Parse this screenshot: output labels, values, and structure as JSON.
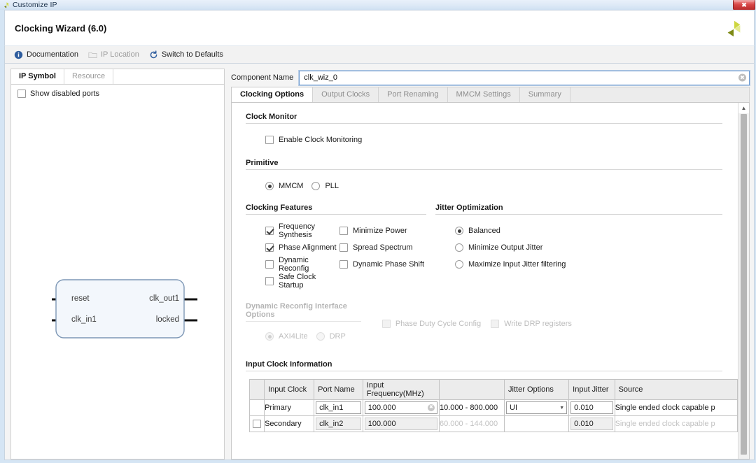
{
  "window": {
    "title": "Customize IP",
    "icon": "xilinx-logo-icon",
    "close_label": "✖"
  },
  "header": {
    "title": "Clocking Wizard (6.0)",
    "logo": "xilinx-logo-icon"
  },
  "toolbar": {
    "items": [
      {
        "label": "Documentation",
        "icon": "info-icon",
        "disabled": false
      },
      {
        "label": "IP Location",
        "icon": "folder-icon",
        "disabled": true
      },
      {
        "label": "Switch to Defaults",
        "icon": "refresh-icon",
        "disabled": false
      }
    ]
  },
  "left_panel": {
    "tabs": [
      {
        "label": "IP Symbol",
        "active": true
      },
      {
        "label": "Resource",
        "active": false
      }
    ],
    "show_disabled_ports": {
      "label": "Show disabled ports",
      "checked": false
    },
    "symbol": {
      "inputs": [
        "reset",
        "clk_in1"
      ],
      "outputs": [
        "clk_out1",
        "locked"
      ]
    }
  },
  "component_name": {
    "label": "Component Name",
    "value": "clk_wiz_0",
    "placeholder": "",
    "clear_icon": "clear-circle-icon"
  },
  "tabs": [
    {
      "label": "Clocking Options",
      "active": true
    },
    {
      "label": "Output Clocks",
      "active": false
    },
    {
      "label": "Port Renaming",
      "active": false
    },
    {
      "label": "MMCM Settings",
      "active": false
    },
    {
      "label": "Summary",
      "active": false
    }
  ],
  "sections": {
    "clock_monitor": {
      "title": "Clock Monitor",
      "options": [
        {
          "label": "Enable Clock Monitoring",
          "checked": false,
          "type": "checkbox"
        }
      ]
    },
    "primitive": {
      "title": "Primitive",
      "options": [
        {
          "label": "MMCM",
          "selected": true
        },
        {
          "label": "PLL",
          "selected": false
        }
      ]
    },
    "clocking_features": {
      "title": "Clocking Features",
      "col_a": [
        {
          "label": "Frequency Synthesis",
          "checked": true
        },
        {
          "label": "Phase Alignment",
          "checked": true
        },
        {
          "label": "Dynamic Reconfig",
          "checked": false
        },
        {
          "label": "Safe Clock Startup",
          "checked": false
        }
      ],
      "col_b": [
        {
          "label": "Minimize Power",
          "checked": false
        },
        {
          "label": "Spread Spectrum",
          "checked": false
        },
        {
          "label": "Dynamic Phase Shift",
          "checked": false
        }
      ]
    },
    "jitter_optimization": {
      "title": "Jitter Optimization",
      "options": [
        {
          "label": "Balanced",
          "selected": true
        },
        {
          "label": "Minimize Output Jitter",
          "selected": false
        },
        {
          "label": "Maximize Input Jitter filtering",
          "selected": false
        }
      ]
    },
    "dynamic_reconfig": {
      "title": "Dynamic Reconfig Interface Options",
      "disabled": true,
      "radios": [
        {
          "label": "AXI4Lite",
          "selected": true
        },
        {
          "label": "DRP",
          "selected": false
        }
      ],
      "checks": [
        {
          "label": "Phase Duty Cycle Config",
          "checked": false
        },
        {
          "label": "Write DRP registers",
          "checked": false
        }
      ]
    },
    "input_clock_information": {
      "title": "Input Clock Information",
      "columns": [
        "",
        "Input Clock",
        "Port Name",
        "Input Frequency(MHz)",
        "",
        "Jitter Options",
        "Input Jitter",
        "Source"
      ],
      "rows": [
        {
          "enabled_checkbox": null,
          "input_clock": "Primary",
          "port_name": "clk_in1",
          "input_frequency": "100.000",
          "range": "10.000 - 800.000",
          "jitter_options": "UI",
          "input_jitter": "0.010",
          "source": "Single ended clock capable p",
          "dim": false
        },
        {
          "enabled_checkbox": false,
          "input_clock": "Secondary",
          "port_name": "clk_in2",
          "input_frequency": "100.000",
          "range": "60.000 - 144.000",
          "jitter_options": "",
          "input_jitter": "0.010",
          "source": "Single ended clock capable p",
          "dim": true
        }
      ]
    }
  },
  "scrollbar": {
    "up_arrow": "▲"
  },
  "colors": {
    "accent_blue": "#1c5ea8",
    "window_frame": "#cfe2f3",
    "close_red": "#c53030",
    "xilinx_green": "#9aa825"
  }
}
